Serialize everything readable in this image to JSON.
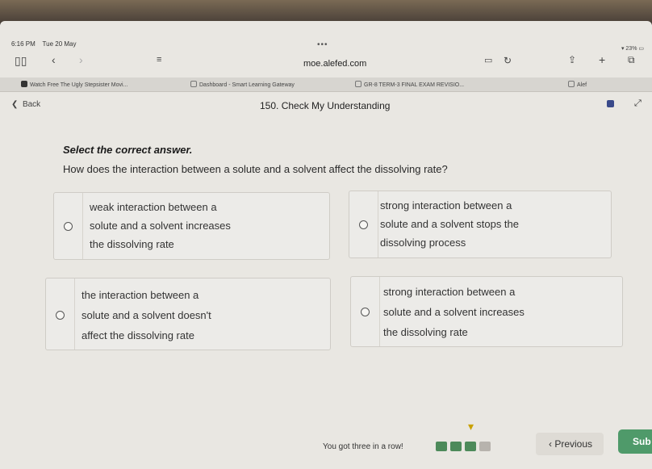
{
  "status": {
    "time": "6:16 PM",
    "date": "Tue 20 May",
    "battery": "23%"
  },
  "browser": {
    "url": "moe.alefed.com",
    "tabs": [
      {
        "label": "Watch Free The Ugly Stepsister Movi..."
      },
      {
        "label": "Dashboard - Smart Learning Gateway"
      },
      {
        "label": "GR-8 TERM-3 FINAL EXAM REVISIO..."
      },
      {
        "label": "Alef"
      }
    ]
  },
  "header": {
    "back_label": "Back",
    "title": "150. Check My Understanding"
  },
  "question": {
    "instruction": "Select the correct answer.",
    "text": "How does the interaction between a solute and a solvent affect the dissolving rate?"
  },
  "options": [
    {
      "text": "weak interaction between a\nsolute and a solvent increases\nthe dissolving rate"
    },
    {
      "text": "strong interaction between a\nsolute and a solvent stops the\ndissolving process"
    },
    {
      "text": "the interaction between a\nsolute and a solvent doesn't\naffect the dissolving rate"
    },
    {
      "text": "strong interaction between a\nsolute and a solvent increases\nthe dissolving rate"
    }
  ],
  "footer": {
    "streak_text": "You got three in a row!",
    "previous_label": "Previous",
    "submit_label": "Sub"
  }
}
